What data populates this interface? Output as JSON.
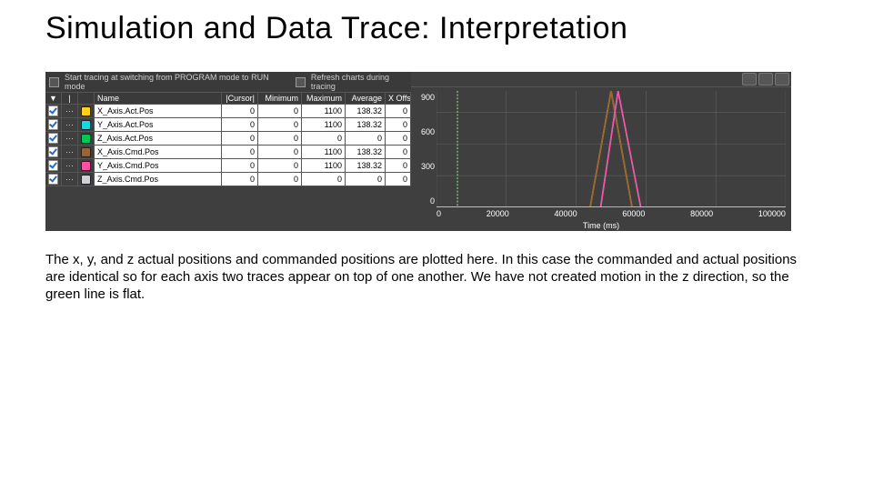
{
  "title": "Simulation and Data Trace: Interpretation",
  "optbar": {
    "opt1": "Start tracing at switching from PROGRAM mode to RUN mode",
    "opt2": "Refresh charts during tracing"
  },
  "headers": {
    "c0": "▼",
    "c1": "|",
    "c2": "",
    "c3": "Name",
    "c4": "|Cursor|",
    "c5": "Minimum",
    "c6": "Maximum",
    "c7": "Average",
    "c8": "X Offse"
  },
  "rows": [
    {
      "color": "#ffd11a",
      "name": "X_Axis.Act.Pos",
      "cur": "0",
      "min": "0",
      "max": "1100",
      "avg": "138.32",
      "xo": "0"
    },
    {
      "color": "#19d6e6",
      "name": "Y_Axis.Act.Pos",
      "cur": "0",
      "min": "0",
      "max": "1100",
      "avg": "138.32",
      "xo": "0"
    },
    {
      "color": "#00c853",
      "name": "Z_Axis.Act.Pos",
      "cur": "0",
      "min": "0",
      "max": "0",
      "avg": "0",
      "xo": "0"
    },
    {
      "color": "#996633",
      "name": "X_Axis.Cmd.Pos",
      "cur": "0",
      "min": "0",
      "max": "1100",
      "avg": "138.32",
      "xo": "0"
    },
    {
      "color": "#ff4fa3",
      "name": "Y_Axis.Cmd.Pos",
      "cur": "0",
      "min": "0",
      "max": "1100",
      "avg": "138.32",
      "xo": "0"
    },
    {
      "color": "#cfcfd6",
      "name": "Z_Axis.Cmd.Pos",
      "cur": "0",
      "min": "0",
      "max": "0",
      "avg": "0",
      "xo": "0"
    }
  ],
  "chart_data": {
    "type": "line",
    "xlabel": "Time (ms)",
    "ylabel": "",
    "xlim": [
      0,
      100000
    ],
    "ylim": [
      0,
      1100
    ],
    "xticks": [
      0,
      20000,
      40000,
      60000,
      80000,
      100000
    ],
    "yticks": [
      0,
      300,
      600,
      900
    ],
    "series": [
      {
        "name": "X_Axis.Act.Pos",
        "color": "#ffd11a",
        "x": [
          0,
          40000,
          44000,
          50000,
          56000,
          60000,
          100000
        ],
        "y": [
          0,
          0,
          0,
          1100,
          0,
          0,
          0
        ]
      },
      {
        "name": "Y_Axis.Act.Pos",
        "color": "#19d6e6",
        "x": [
          0,
          43000,
          47000,
          52000,
          58500,
          62500,
          100000
        ],
        "y": [
          0,
          0,
          0,
          1100,
          0,
          0,
          0
        ]
      },
      {
        "name": "Z_Axis.Act.Pos",
        "color": "#00c853",
        "x": [
          0,
          100000
        ],
        "y": [
          0,
          0
        ]
      },
      {
        "name": "X_Axis.Cmd.Pos",
        "color": "#996633",
        "x": [
          0,
          40000,
          44000,
          50000,
          56000,
          60000,
          100000
        ],
        "y": [
          0,
          0,
          0,
          1100,
          0,
          0,
          0
        ]
      },
      {
        "name": "Y_Axis.Cmd.Pos",
        "color": "#ff4fa3",
        "x": [
          0,
          43000,
          47000,
          52000,
          58500,
          62500,
          100000
        ],
        "y": [
          0,
          0,
          0,
          1100,
          0,
          0,
          0
        ]
      },
      {
        "name": "Z_Axis.Cmd.Pos",
        "color": "#cfcfd6",
        "x": [
          0,
          100000
        ],
        "y": [
          0,
          0
        ]
      }
    ],
    "cursor_x": 6000
  },
  "caption": "The x, y, and z actual positions and commanded positions are plotted here. In this case the commanded and actual positions are identical so for each axis two traces appear on top of one another. We have not created motion in the z direction, so the green line is flat."
}
